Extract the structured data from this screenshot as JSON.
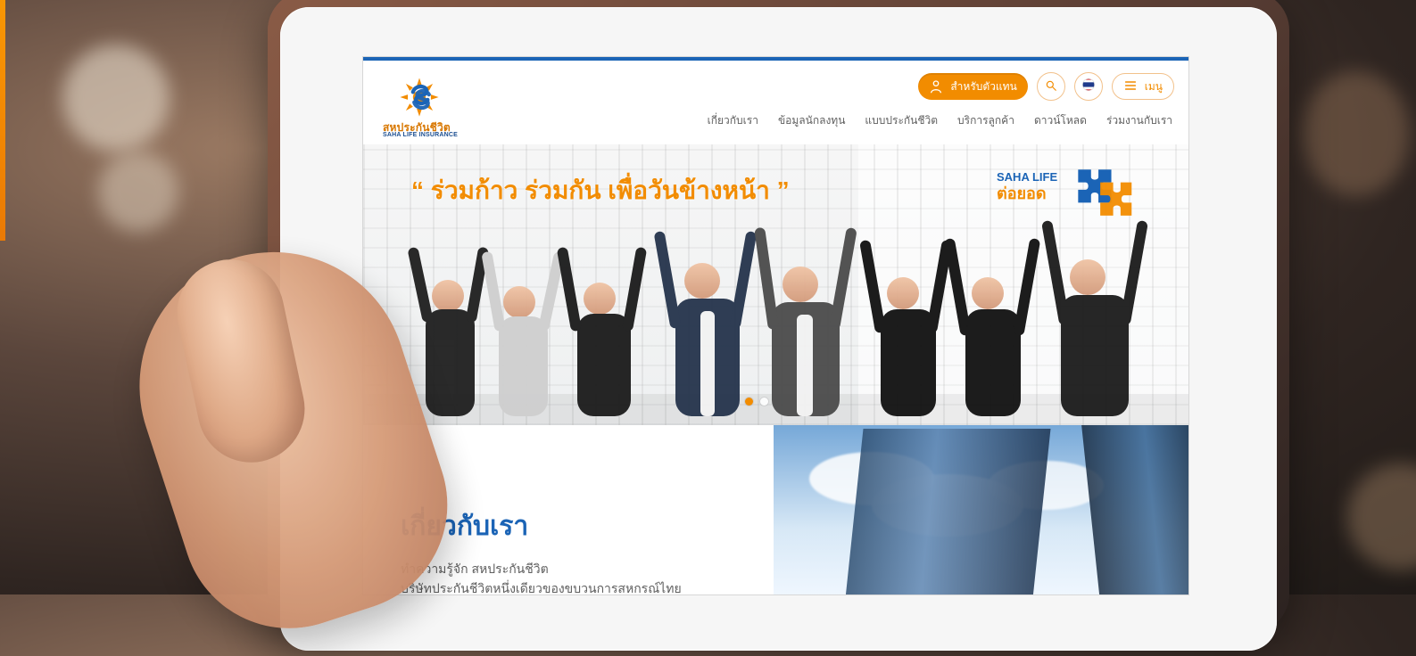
{
  "site": {
    "brand_name": "สหประกันชีวิต",
    "brand_sub": "SAHA LIFE INSURANCE"
  },
  "header": {
    "primary_cta": "สำหรับตัวแทน",
    "menu_label": "เมนู",
    "nav": [
      "เกี่ยวกับเรา",
      "ข้อมูลนักลงทุน",
      "แบบประกันชีวิต",
      "บริการลูกค้า",
      "ดาวน์โหลด",
      "ร่วมงานกับเรา"
    ]
  },
  "hero": {
    "quote": "“ ร่วมก้าว ร่วมกัน เพื่อวันข้างหน้า ”",
    "logo_top": "SAHA LIFE",
    "logo_bottom": "ต่อยอด",
    "slides_count": 2,
    "active_slide": 1
  },
  "about": {
    "title": "เกี่ยวกับเรา",
    "line1": "ทำความรู้จัก สหประกันชีวิต",
    "line2": "บริษัทประกันชีวิตหนึ่งเดียวของขบวนการสหกรณ์ไทย"
  },
  "colors": {
    "orange": "#f28c00",
    "blue": "#1b64b6"
  },
  "icons": {
    "agent": "person-icon",
    "search": "search-icon",
    "flag": "thai-flag-icon",
    "menu": "menu-icon"
  }
}
